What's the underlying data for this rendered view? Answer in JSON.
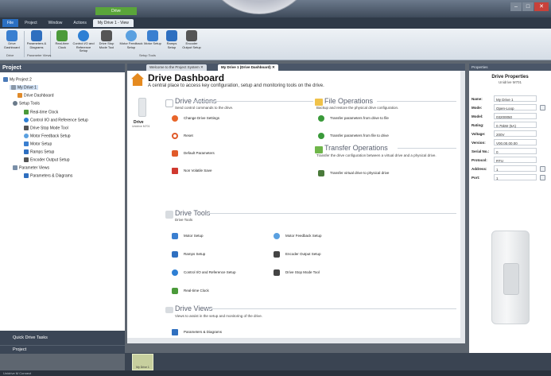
{
  "window": {
    "context_tab": "Drive",
    "controls": [
      "–",
      "□",
      "✕"
    ]
  },
  "menu": {
    "items": [
      "File",
      "Project",
      "Window",
      "Actions",
      "My Drive 1 - View"
    ]
  },
  "ribbon": {
    "buttons": [
      {
        "label": "Drive Dashboard",
        "icon": "home-icon",
        "color": "#3a7fd0"
      },
      {
        "label": "Parameters & Diagrams",
        "icon": "parameters-icon",
        "color": "#2f6fbf"
      },
      {
        "label": "Real-time Clock",
        "icon": "clock-icon",
        "color": "#4b9a3a"
      },
      {
        "label": "Control I/O and Reference Setup",
        "icon": "control-io-icon",
        "color": "#2e7fd4"
      },
      {
        "label": "Drive Stop Mode Tool",
        "icon": "drive-stop-icon",
        "color": "#555"
      },
      {
        "label": "Motor Feedback Setup",
        "icon": "motor-feedback-icon",
        "color": "#5aa0e0"
      },
      {
        "label": "Motor Setup",
        "icon": "motor-setup-icon",
        "color": "#3a7fd0"
      },
      {
        "label": "Ramps Setup",
        "icon": "ramps-icon",
        "color": "#2e6fc0"
      },
      {
        "label": "Encoder Output Setup",
        "icon": "encoder-icon",
        "color": "#555"
      }
    ],
    "groups": [
      "Drive",
      "Parameter Views",
      "Setup Tools"
    ]
  },
  "project": {
    "title": "Project",
    "tree": [
      {
        "label": "My Project 2",
        "level": 0
      },
      {
        "label": "My Drive 1",
        "level": 1
      },
      {
        "label": "Drive Dashboard",
        "level": 2
      },
      {
        "label": "Setup Tools",
        "level": 2
      },
      {
        "label": "Real-time Clock",
        "level": 3
      },
      {
        "label": "Control I/O and Reference Setup",
        "level": 3
      },
      {
        "label": "Drive Stop Mode Tool",
        "level": 3
      },
      {
        "label": "Motor Feedback Setup",
        "level": 3
      },
      {
        "label": "Motor Setup",
        "level": 3
      },
      {
        "label": "Ramps Setup",
        "level": 3
      },
      {
        "label": "Encoder Output Setup",
        "level": 3
      },
      {
        "label": "Parameter Views",
        "level": 2
      },
      {
        "label": "Parameters & Diagrams",
        "level": 3
      }
    ],
    "quick_tasks": "Quick Drive Tasks",
    "bottom_tab": "Project"
  },
  "doc_tabs": [
    "Welcome to the Project System ✕",
    "My Drive 1 (Drive Dashboard) ✕"
  ],
  "dashboard": {
    "title": "Drive Dashboard",
    "subtitle": "A central place to access key configuration, setup and monitoring tools on the drive.",
    "drive_label": "Drive",
    "drive_sublabel": "Unidrive M701",
    "drive_actions": {
      "title": "Drive Actions",
      "sub": "Send control commands to the drive.",
      "items": [
        "Change Drive Settings",
        "Reset",
        "Default Parameters",
        "Non Volatile Save"
      ]
    },
    "file_operations": {
      "title": "File Operations",
      "sub": "Backup and restore the physical drive configuration.",
      "items": [
        "Transfer parameters from drive to file",
        "Transfer parameters from file to drive"
      ]
    },
    "transfer_operations": {
      "title": "Transfer Operations",
      "sub": "Transfer the drive configuration between a virtual drive and a physical drive.",
      "items": [
        "Transfer virtual drive to physical drive"
      ]
    },
    "drive_tools": {
      "title": "Drive Tools",
      "sub": "Drive Tools",
      "items": [
        "Motor Setup",
        "Motor Feedback Setup",
        "Ramps Setup",
        "Encoder Output Setup",
        "Control I/O and Reference Setup",
        "Drive Stop Mode Tool",
        "Real-time Clock"
      ]
    },
    "drive_views": {
      "title": "Drive Views",
      "sub": "Views to assist in the setup and monitoring of the drive.",
      "items": [
        "Parameters & Diagrams"
      ]
    }
  },
  "properties": {
    "header": "Properties",
    "title": "Drive Properties",
    "subtitle": "Unidrive M701",
    "rows": [
      {
        "name": "Name:",
        "value": "My Drive 1"
      },
      {
        "name": "Mode:",
        "value": "Open-Loop"
      },
      {
        "name": "Model:",
        "value": "03200050"
      },
      {
        "name": "Rating:",
        "value": "0.75kW (5A)"
      },
      {
        "name": "Voltage:",
        "value": "200V"
      },
      {
        "name": "Version:",
        "value": "V00.00.00.00"
      },
      {
        "name": "Serial No.:",
        "value": "0"
      },
      {
        "name": "Protocol:",
        "value": "RTU"
      },
      {
        "name": "Address:",
        "value": "1"
      },
      {
        "name": "Port:",
        "value": "1"
      }
    ]
  },
  "tray": {
    "thumb_label": "My Drive 1"
  },
  "status": {
    "text": "Unidrive M Connect"
  }
}
